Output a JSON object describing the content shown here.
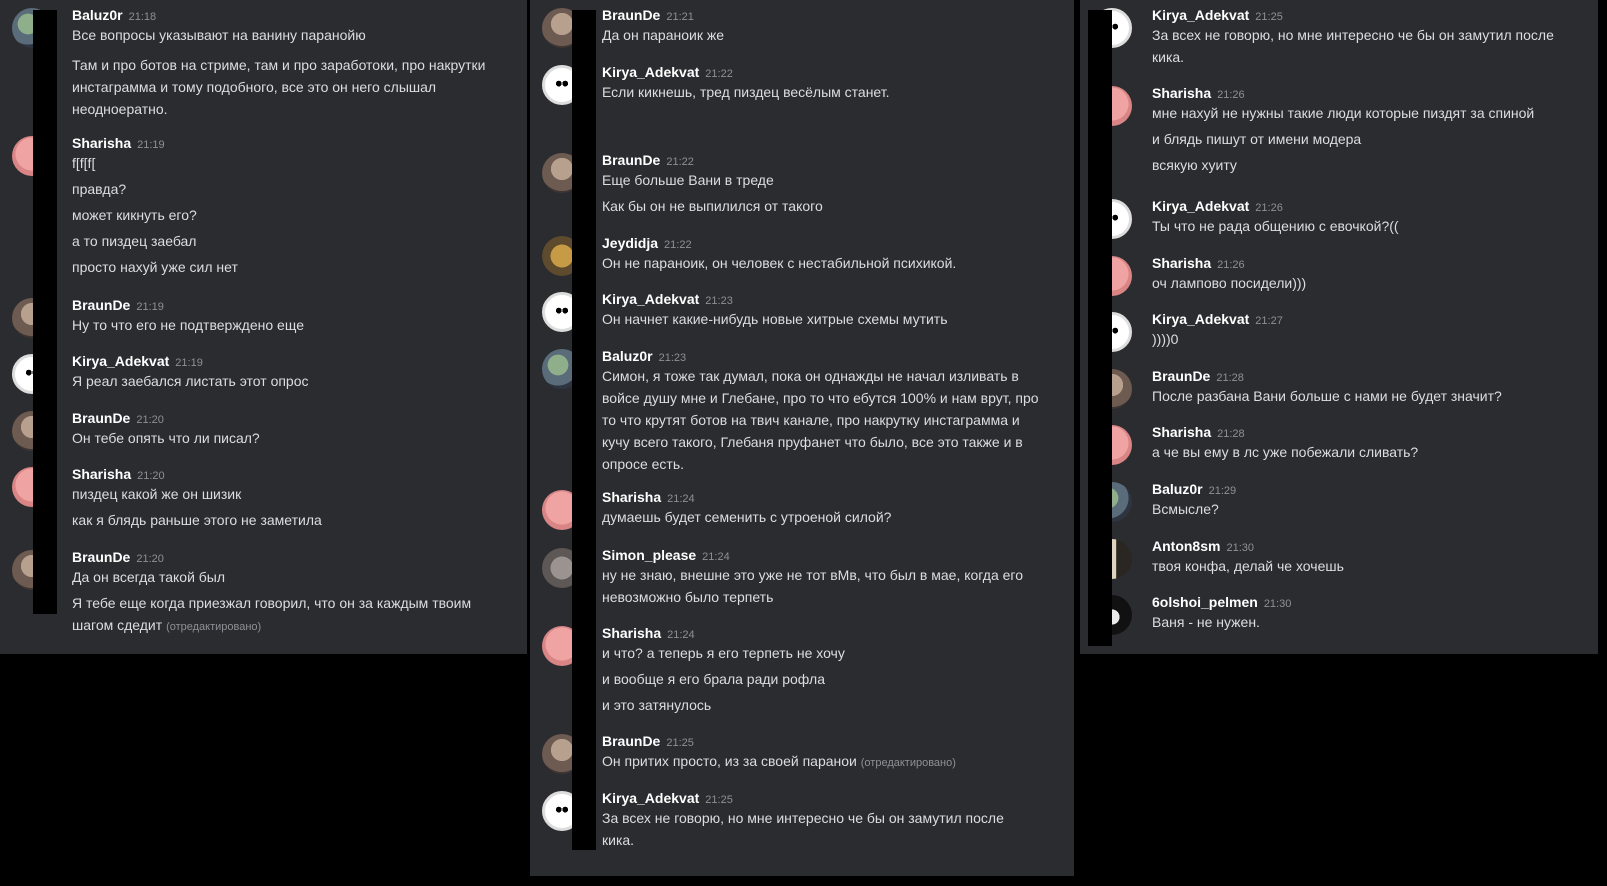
{
  "edited_label": "(отредактировано)",
  "panels": [
    {
      "messages": [
        {
          "author": "Baluz0r",
          "time": "21:18",
          "lines": [
            "Все вопросы указывают на ванину паранойю",
            "Там и про ботов на стриме, там и про заработоки, про накрутки",
            "инстаграмма и тому подобного, все это он него слышал",
            "неодноератно."
          ]
        },
        {
          "author": "Sharisha",
          "time": "21:19",
          "lines": [
            "f[f[f[",
            "правда?",
            "может кикнуть его?",
            "а то пиздец заебал",
            "просто нахуй уже сил нет"
          ]
        },
        {
          "author": "BraunDe",
          "time": "21:19",
          "lines": [
            "Ну то что его не подтверждено еще"
          ]
        },
        {
          "author": "Kirya_Adekvat",
          "time": "21:19",
          "lines": [
            "Я реал заебался листать этот опрос"
          ]
        },
        {
          "author": "BraunDe",
          "time": "21:20",
          "lines": [
            "Он тебе опять что ли писал?"
          ]
        },
        {
          "author": "Sharisha",
          "time": "21:20",
          "lines": [
            "пиздец какой же он шизик",
            "как я блядь раньше этого не заметила"
          ]
        },
        {
          "author": "BraunDe",
          "time": "21:20",
          "lines": [
            "Да он всегда такой был",
            "Я тебе еще когда приезжал говорил, что он за каждым твоим",
            "шагом сдедит"
          ]
        }
      ]
    },
    {
      "messages": [
        {
          "author": "BraunDe",
          "time": "21:21",
          "lines": [
            "Да он параноик же"
          ]
        },
        {
          "author": "Kirya_Adekvat",
          "time": "21:22",
          "lines": [
            "Если кикнешь, тред пиздец весёлым станет."
          ]
        },
        {
          "author": "BraunDe",
          "time": "21:22",
          "lines": [
            "Еще больше Вани в треде",
            "Как бы он не выпилился от такого"
          ]
        },
        {
          "author": "Jeydidja",
          "time": "21:22",
          "lines": [
            "Он не параноик, он человек с нестабильной психикой."
          ]
        },
        {
          "author": "Kirya_Adekvat",
          "time": "21:23",
          "lines": [
            "Он начнет какие-нибудь новые хитрые схемы мутить"
          ]
        },
        {
          "author": "Baluz0r",
          "time": "21:23",
          "lines": [
            "Симон, я тоже так думал, пока он однажды не начал изливать в",
            "войсе душу мне и Глебане, про то что ебутся 100% и нам врут, про",
            "то что крутят ботов на твич канале, про накрутку инстаграмма и",
            "кучу всего такого, Глебаня пруфанет что было, все это также и в",
            "опросе есть."
          ]
        },
        {
          "author": "Sharisha",
          "time": "21:24",
          "lines": [
            "думаешь будет семенить с утроеной силой?"
          ]
        },
        {
          "author": "Simon_please",
          "time": "21:24",
          "lines": [
            "ну не знаю, внешне это уже не тот вМв, что был в мае, когда его",
            "невозможно было терпеть"
          ]
        },
        {
          "author": "Sharisha",
          "time": "21:24",
          "lines": [
            "и что? а теперь я его терпеть не хочу",
            "и вообще я его брала ради рофла",
            "и это затянулось"
          ]
        },
        {
          "author": "BraunDe",
          "time": "21:25",
          "lines": [
            "Он притих просто, из за своей паранои"
          ]
        },
        {
          "author": "Kirya_Adekvat",
          "time": "21:25",
          "lines": [
            "За всех не говорю, но мне интересно че бы он замутил после",
            "кика."
          ]
        }
      ]
    },
    {
      "messages": [
        {
          "author": "Kirya_Adekvat",
          "time": "21:25",
          "lines": [
            "За всех не говорю, но мне интересно че бы он замутил после",
            "кика."
          ]
        },
        {
          "author": "Sharisha",
          "time": "21:26",
          "lines": [
            "мне нахуй не нужны такие люди которые пиздят за спиной",
            "и блядь пишут от имени модера",
            "всякую хуиту"
          ]
        },
        {
          "author": "Kirya_Adekvat",
          "time": "21:26",
          "lines": [
            "Ты что не рада  общению с евочкой?(("
          ]
        },
        {
          "author": "Sharisha",
          "time": "21:26",
          "lines": [
            "оч лампово посидели)))"
          ]
        },
        {
          "author": "Kirya_Adekvat",
          "time": "21:27",
          "lines": [
            "))))0"
          ]
        },
        {
          "author": "BraunDe",
          "time": "21:28",
          "lines": [
            "После разбана Вани больше с нами не будет значит?"
          ]
        },
        {
          "author": "Sharisha",
          "time": "21:28",
          "lines": [
            "а че вы ему в лс уже побежали сливать?"
          ]
        },
        {
          "author": "Baluz0r",
          "time": "21:29",
          "lines": [
            "Всмысле?"
          ]
        },
        {
          "author": "Anton8sm",
          "time": "21:30",
          "lines": [
            "твоя конфа, делай че хочешь"
          ]
        },
        {
          "author": "6olshoi_pelmen",
          "time": "21:30",
          "lines": [
            "Ваня - не нужен."
          ]
        }
      ]
    }
  ]
}
